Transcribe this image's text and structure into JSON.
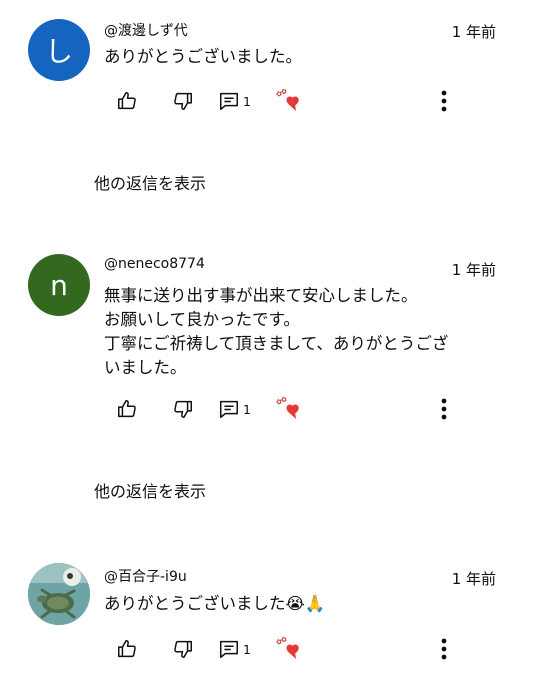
{
  "comments": [
    {
      "avatar_letter": "し",
      "avatar_color": "#1565c0",
      "handle": "@渡邊しず代",
      "time": "1 年前",
      "text": "ありがとうございました。",
      "reply_count": "1",
      "hearted_label": "ハート"
    },
    {
      "avatar_letter": "n",
      "avatar_color": "#33691e",
      "handle": "@neneco8774",
      "time": "1 年前",
      "text": "無事に送り出す事が出来て安心しました。\nお願いして良かったです。\n丁寧にご祈祷して頂きまして、ありがとうござ\nいました。",
      "reply_count": "1",
      "hearted_label": "ハート"
    },
    {
      "avatar_letter": "",
      "avatar_color": "#5a8a8c",
      "handle": "@百合子-i9u",
      "time": "1 年前",
      "text": "ありがとうございました😭🙏",
      "reply_count": "1",
      "hearted_label": "ハート"
    }
  ],
  "show_replies_label": "他の返信を表示",
  "icons": {
    "like": "thumbs-up-icon",
    "dislike": "thumbs-down-icon",
    "reply": "reply-comment-icon",
    "heart": "creator-heart-icon",
    "more": "more-vertical-icon"
  }
}
